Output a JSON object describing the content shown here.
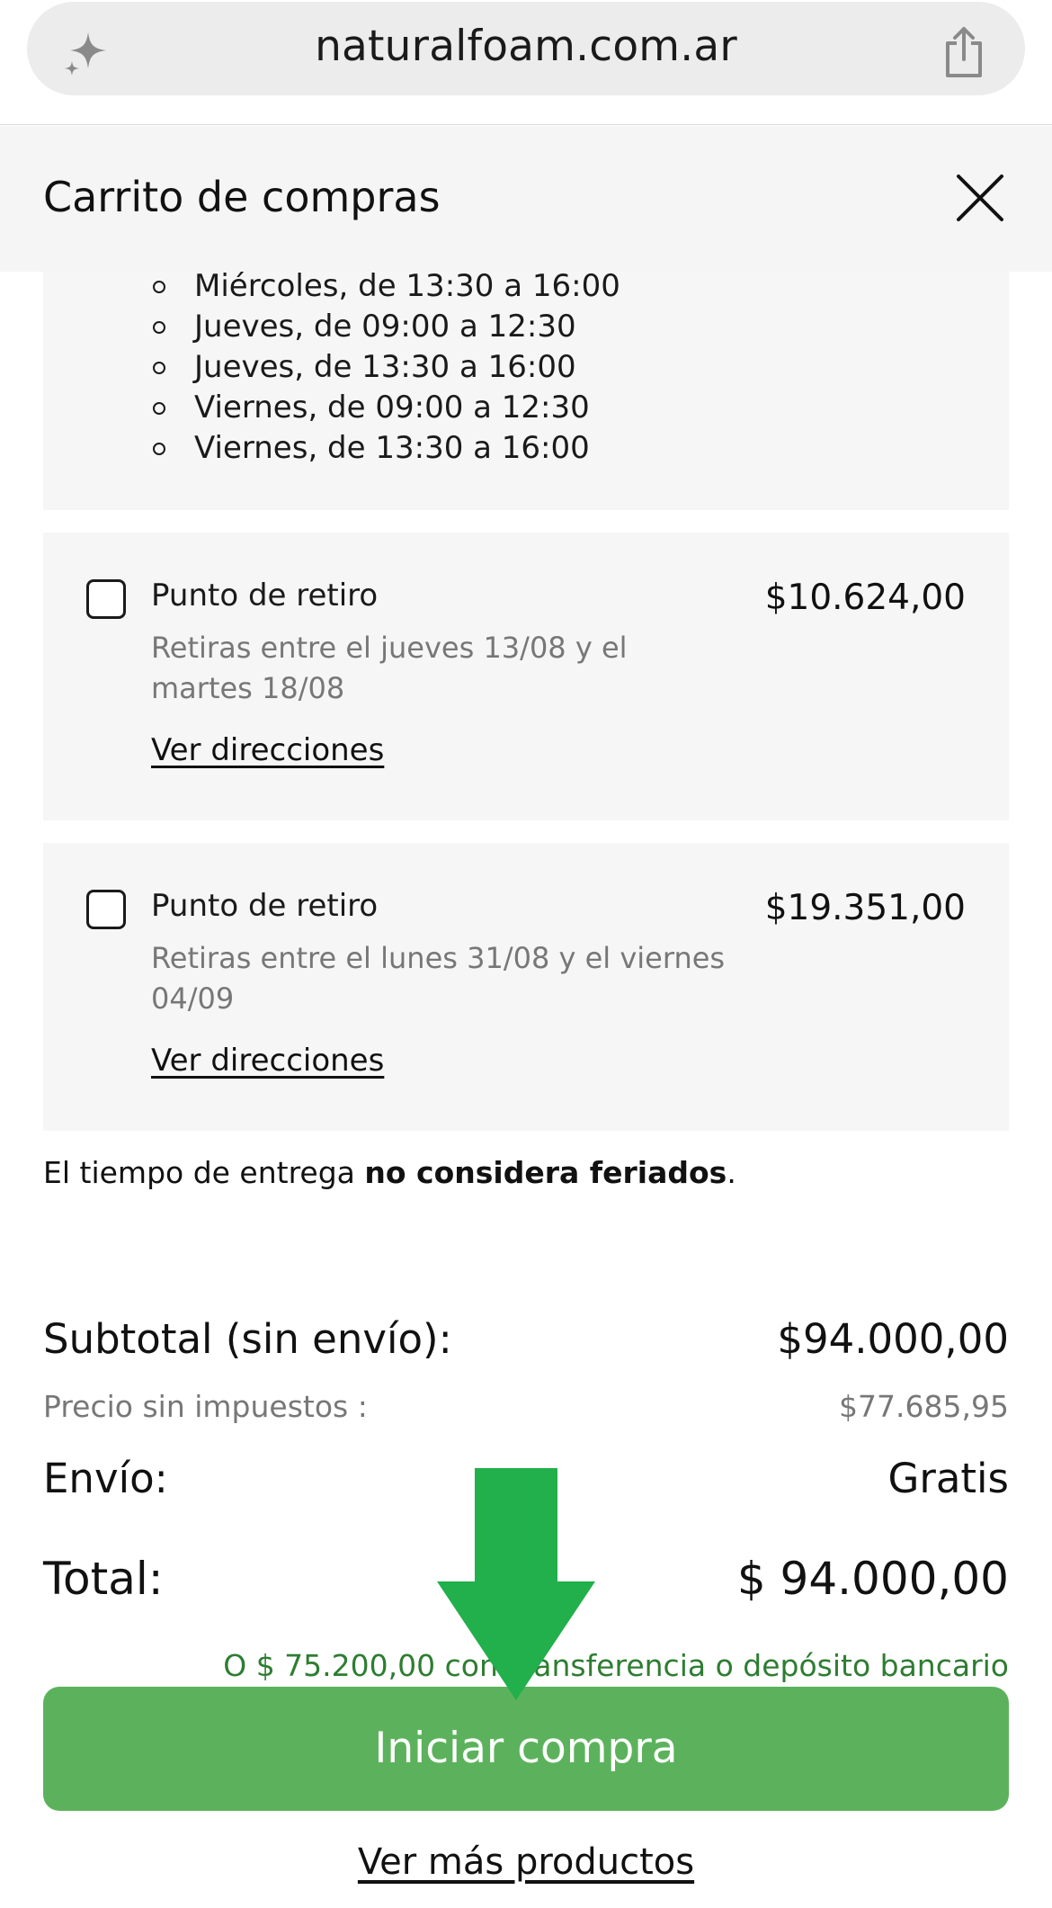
{
  "browser": {
    "url": "naturalfoam.com.ar",
    "left_icon": "sparkle-icon",
    "right_icon": "share-icon"
  },
  "cart": {
    "title": "Carrito de compras",
    "close_icon": "close-icon"
  },
  "schedule": {
    "items": [
      "Miércoles, de 13:30 a 16:00",
      "Jueves, de 09:00 a 12:30",
      "Jueves, de 13:30 a 16:00",
      "Viernes, de 09:00 a 12:30",
      "Viernes, de 13:30 a 16:00"
    ]
  },
  "options": [
    {
      "title": "Punto de retiro",
      "price": "$10.624,00",
      "description": "Retiras entre el jueves 13/08 y el martes 18/08",
      "link": "Ver direcciones",
      "checked": false
    },
    {
      "title": "Punto de retiro",
      "price": "$19.351,00",
      "description": "Retiras entre el lunes 31/08 y el viernes 04/09",
      "link": "Ver direcciones",
      "checked": false
    }
  ],
  "delivery_note": {
    "prefix": "El tiempo de entrega ",
    "bold": "no considera feriados",
    "suffix": "."
  },
  "totals": {
    "subtotal_label": "Subtotal (sin envío):",
    "subtotal_value": "$94.000,00",
    "no_tax_label": "Precio sin impuestos :",
    "no_tax_value": "$77.685,95",
    "shipping_label": "Envío:",
    "shipping_value": "Gratis",
    "total_label": "Total:",
    "total_value": "$ 94.000,00",
    "transfer_text": "O $ 75.200,00 con Transferencia o depósito bancario"
  },
  "actions": {
    "start_purchase": "Iniciar compra",
    "see_more": "Ver más productos"
  },
  "colors": {
    "cta_green": "#5cb25c",
    "arrow_green": "#21b04b",
    "transfer_green": "#2e7d32"
  }
}
